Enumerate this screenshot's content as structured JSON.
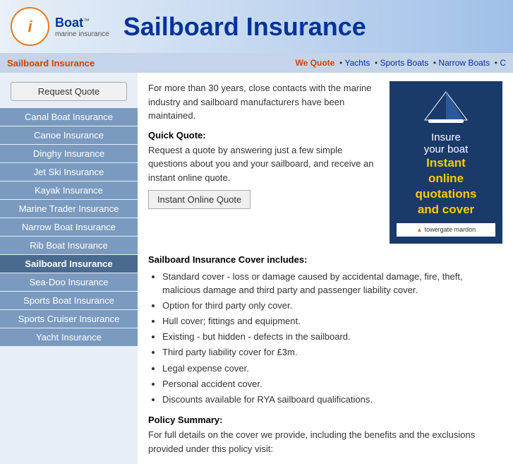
{
  "header": {
    "logo_i": "i",
    "logo_boat": "Boat",
    "logo_tm": "™",
    "logo_subtitle": "marine insurance",
    "title": "Sailboard Insurance"
  },
  "nav": {
    "current": "Sailboard Insurance",
    "quote_label": "We Quote",
    "links": [
      "Yachts",
      "Sports Boats",
      "Narrow Boats",
      "C"
    ]
  },
  "sidebar": {
    "request_quote_label": "Request Quote",
    "items": [
      {
        "label": "Canal Boat Insurance",
        "active": false
      },
      {
        "label": "Canoe Insurance",
        "active": false
      },
      {
        "label": "Dinghy Insurance",
        "active": false
      },
      {
        "label": "Jet Ski Insurance",
        "active": false
      },
      {
        "label": "Kayak Insurance",
        "active": false
      },
      {
        "label": "Marine Trader Insurance",
        "active": false
      },
      {
        "label": "Narrow Boat Insurance",
        "active": false
      },
      {
        "label": "Rib Boat Insurance",
        "active": false
      },
      {
        "label": "Sailboard Insurance",
        "active": true
      },
      {
        "label": "Sea-Doo Insurance",
        "active": false
      },
      {
        "label": "Sports Boat Insurance",
        "active": false
      },
      {
        "label": "Sports Cruiser Insurance",
        "active": false
      },
      {
        "label": "Yacht Insurance",
        "active": false
      }
    ]
  },
  "content": {
    "intro": "For more than 30 years, close contacts with the marine industry and sailboard manufacturers have been maintained.",
    "quick_quote_label": "Quick Quote:",
    "quick_quote_desc": "Request a quote by answering just a few simple questions about you and your sailboard, and receive an instant online quote.",
    "instant_quote_btn": "Instant Online Quote",
    "ad": {
      "line1": "Insure",
      "line2": "your boat",
      "line3": "Instant",
      "line4": "online",
      "line5": "quotations",
      "line6": "and cover",
      "brand": "towergate mardon"
    },
    "cover_title": "Sailboard Insurance Cover includes:",
    "cover_items": [
      "Standard cover - loss or damage caused by accidental damage, fire, theft, malicious damage and third party and passenger liability cover.",
      "Option for third party only cover.",
      "Hull cover; fittings and equipment.",
      "Existing - but hidden - defects in the sailboard.",
      "Third party liability cover for £3m.",
      "Legal expense cover.",
      "Personal accident cover.",
      "Discounts available for RYA sailboard qualifications."
    ],
    "policy_title": "Policy Summary:",
    "policy_text": "For full details on the cover we provide, including the benefits and the exclusions provided under this policy visit:"
  }
}
